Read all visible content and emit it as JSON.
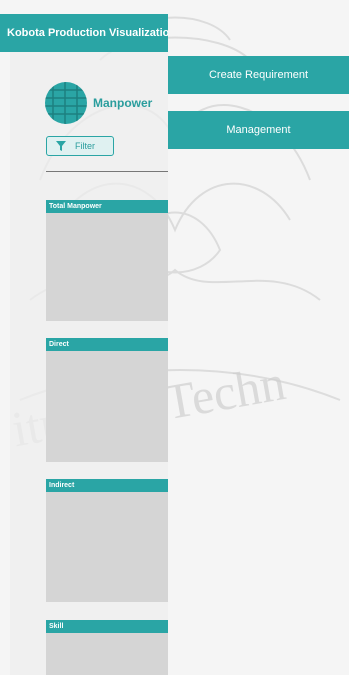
{
  "app": {
    "title": "Kobota Production Visualization"
  },
  "sidebar": {
    "department": "Manpower",
    "filter_label": "Filter",
    "cards": [
      {
        "title": "Total Manpower"
      },
      {
        "title": "Direct"
      },
      {
        "title": "Indirect"
      },
      {
        "title": "Skill"
      }
    ]
  },
  "nav": {
    "create_requirement": "Create Requirement",
    "management": "Management"
  },
  "watermark": {
    "text": "itute of Techn"
  },
  "colors": {
    "accent": "#2aa5a5",
    "accent_text": "#2a9d9d",
    "card_body": "#d5d5d5"
  }
}
